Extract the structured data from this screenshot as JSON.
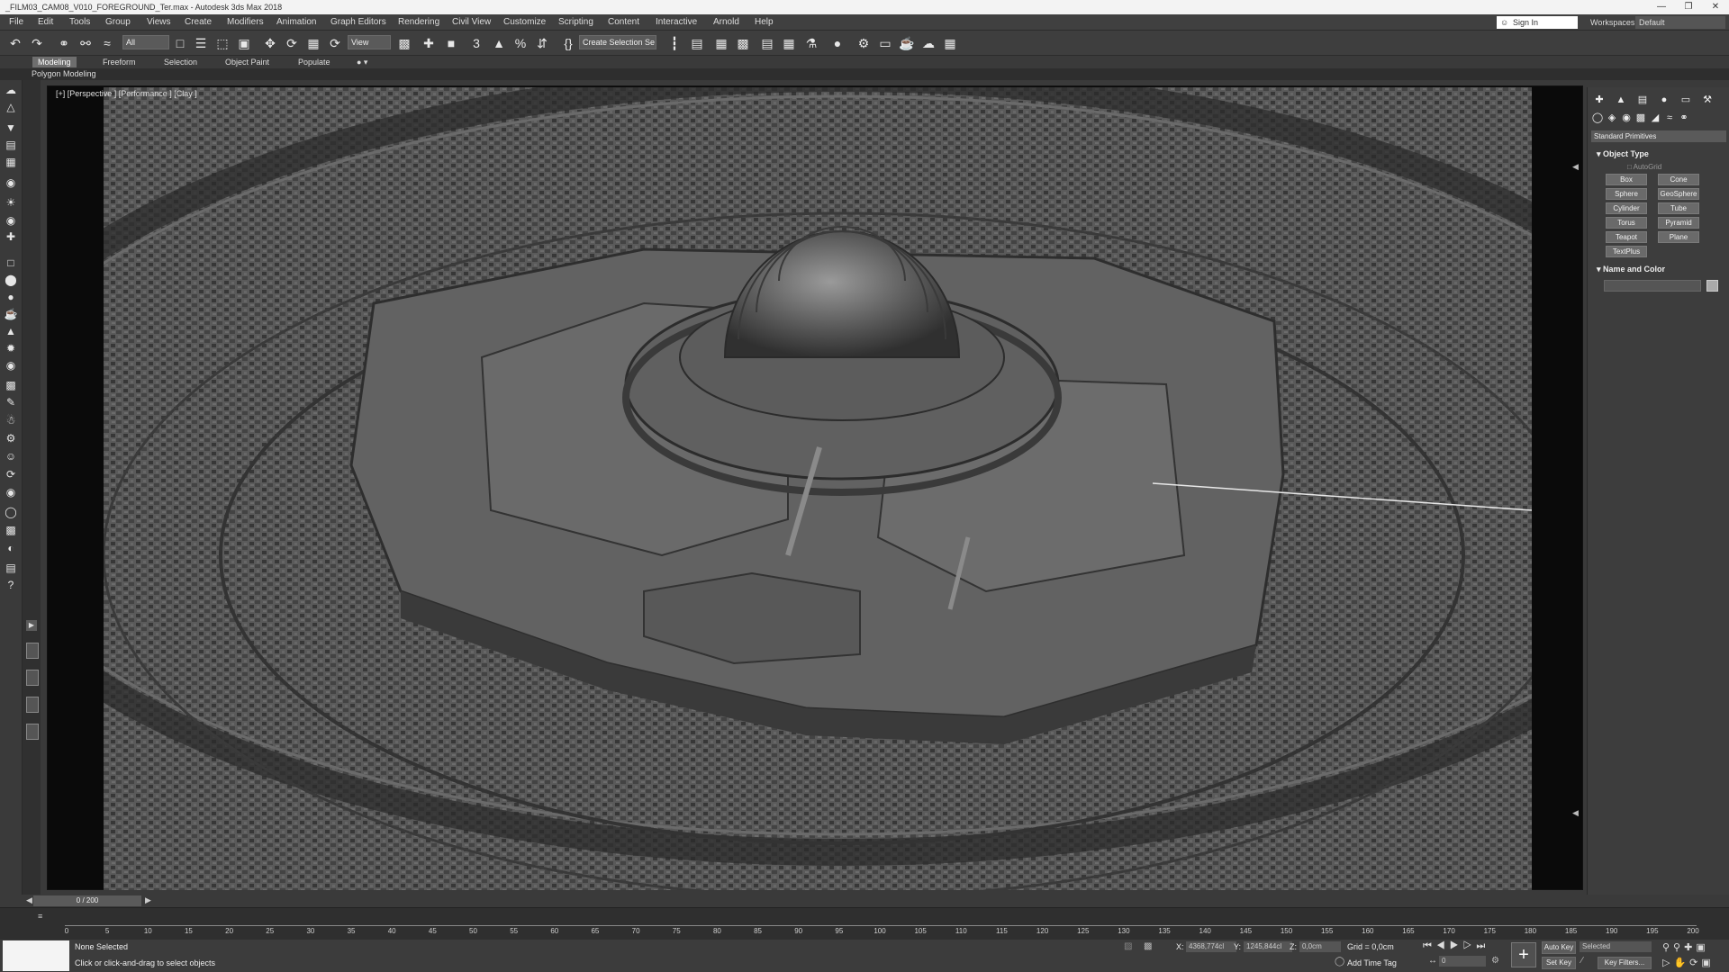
{
  "window": {
    "title": "_FILM03_CAM08_V010_FOREGROUND_Ter.max - Autodesk 3ds Max 2018",
    "controls": [
      "—",
      "❐",
      "✕"
    ]
  },
  "menu": [
    "File",
    "Edit",
    "Tools",
    "Group",
    "Views",
    "Create",
    "Modifiers",
    "Animation",
    "Graph Editors",
    "Rendering",
    "Civil View",
    "Customize",
    "Scripting",
    "Content",
    "Interactive",
    "Arnold",
    "Help"
  ],
  "signin": "Sign In",
  "workspaces": {
    "label": "Workspaces:",
    "value": "Default"
  },
  "toolbar": {
    "selection_filter": "All",
    "ref_coord": "View",
    "named_selection": "Create Selection Se"
  },
  "ribbon": {
    "tabs": [
      "Modeling",
      "Freeform",
      "Selection",
      "Object Paint",
      "Populate"
    ],
    "active": "Modeling",
    "sub": "Polygon Modeling"
  },
  "viewport": {
    "label": "[+] [Perspective ] [Performance ] [Clay ]"
  },
  "command_panel": {
    "category": "Standard Primitives",
    "object_type": "Object Type",
    "autogrid": "AutoGrid",
    "buttons": [
      "Box",
      "Cone",
      "Sphere",
      "GeoSphere",
      "Cylinder",
      "Tube",
      "Torus",
      "Pyramid",
      "Teapot",
      "Plane",
      "TextPlus"
    ],
    "name_and_color": "Name and Color"
  },
  "timeline": {
    "slider": "0 / 200",
    "ticks": [
      "0",
      "5",
      "10",
      "15",
      "20",
      "25",
      "30",
      "35",
      "40",
      "45",
      "50",
      "55",
      "60",
      "65",
      "70",
      "75",
      "80",
      "85",
      "90",
      "95",
      "100",
      "105",
      "110",
      "115",
      "120",
      "125",
      "130",
      "135",
      "140",
      "145",
      "150",
      "155",
      "160",
      "165",
      "170",
      "175",
      "180",
      "185",
      "190",
      "195",
      "200"
    ]
  },
  "status": {
    "selection": "None Selected",
    "prompt": "Click or click-and-drag to select objects",
    "x_label": "X:",
    "x": "4368,774cl",
    "y_label": "Y:",
    "y": "1245,844cl",
    "z_label": "Z:",
    "z": "0,0cm",
    "grid": "Grid = 0,0cm",
    "add_time_tag": "Add Time Tag",
    "auto_key": "Auto Key",
    "set_key": "Set Key",
    "key_mode": "Selected",
    "key_filters": "Key Filters...",
    "frame": "0"
  }
}
